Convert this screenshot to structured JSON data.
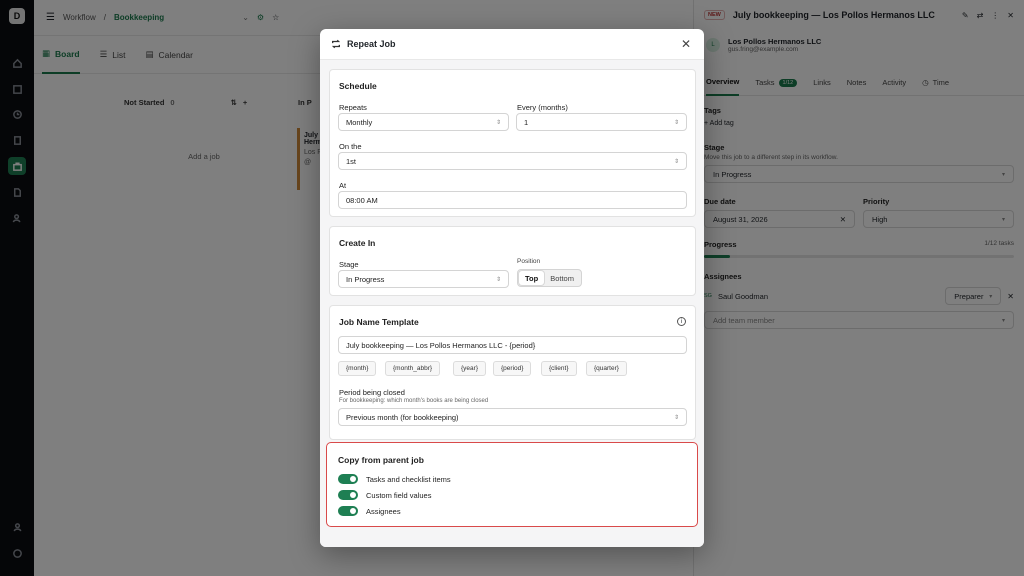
{
  "app": {
    "logo": "D"
  },
  "breadcrumb": {
    "root": "Workflow",
    "current": "Bookkeeping"
  },
  "view_tabs": [
    {
      "label": "Board"
    },
    {
      "label": "List"
    },
    {
      "label": "Calendar"
    }
  ],
  "board": {
    "columns": [
      {
        "name": "Not Started",
        "count": "0",
        "add_label": "Add a job"
      },
      {
        "name": "In P",
        "count": ""
      }
    ],
    "card": {
      "title": "July",
      "line2": "Herma",
      "client": "Los Po",
      "meta": "@"
    }
  },
  "drawer": {
    "badge": "NEW",
    "title": "July bookkeeping — Los Pollos Hermanos LLC",
    "client_initial": "L",
    "client_name": "Los Pollos Hermanos LLC",
    "client_email": "gus.fring@example.com",
    "tabs": [
      {
        "label": "Overview"
      },
      {
        "label": "Tasks",
        "count": "1/12"
      },
      {
        "label": "Links"
      },
      {
        "label": "Notes"
      },
      {
        "label": "Activity"
      },
      {
        "label": "Time"
      }
    ],
    "tags_label": "Tags",
    "add_tag": "Add tag",
    "stage_label": "Stage",
    "stage_hint": "Move this job to a different step in its workflow.",
    "stage_value": "In Progress",
    "due_label": "Due date",
    "due_value": "August 31, 2026",
    "priority_label": "Priority",
    "priority_value": "High",
    "progress_label": "Progress",
    "progress_value": "1/12 tasks",
    "progress_fraction": 0.083,
    "assignees_label": "Assignees",
    "assignee_initials": "SG",
    "assignee_name": "Saul Goodman",
    "assignee_role": "Preparer",
    "add_member_placeholder": "Add team member"
  },
  "modal": {
    "title": "Repeat Job",
    "schedule": {
      "title": "Schedule",
      "repeats_label": "Repeats",
      "repeats_value": "Monthly",
      "every_label": "Every (months)",
      "every_value": "1",
      "on_label": "On the",
      "on_value": "1st",
      "at_label": "At",
      "at_value": "08:00 AM"
    },
    "create_in": {
      "title": "Create In",
      "stage_label": "Stage",
      "stage_value": "In Progress",
      "position_label": "Position",
      "position_options": [
        {
          "label": "Top"
        },
        {
          "label": "Bottom"
        }
      ]
    },
    "template": {
      "title": "Job Name Template",
      "value": "July bookkeeping — Los Pollos Hermanos LLC - {period}",
      "chips": [
        "{month}",
        "{month_abbr}",
        "{year}",
        "{period}",
        "{client}",
        "{quarter}"
      ],
      "period_label": "Period being closed",
      "period_hint": "For bookkeeping: which month's books are being closed",
      "period_value": "Previous month (for bookkeeping)"
    },
    "copy": {
      "title": "Copy from parent job",
      "items": [
        {
          "label": "Tasks and checklist items",
          "on": true
        },
        {
          "label": "Custom field values",
          "on": true
        },
        {
          "label": "Assignees",
          "on": true
        }
      ]
    }
  },
  "colors": {
    "accent": "#1e7f53",
    "highlight": "#d94a4a",
    "overlay": "rgba(0,0,0,0.5)"
  }
}
